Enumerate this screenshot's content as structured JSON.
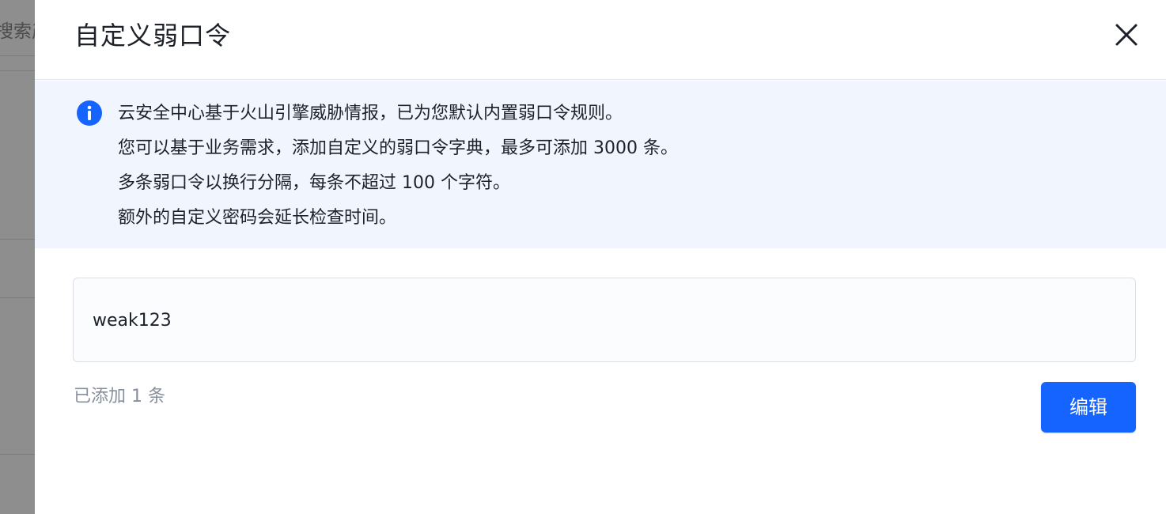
{
  "background": {
    "search_fragment": "搜索产"
  },
  "drawer": {
    "title": "自定义弱口令",
    "notice": {
      "lines": [
        "云安全中心基于火山引擎威胁情报，已为您默认内置弱口令规则。",
        "您可以基于业务需求，添加自定义的弱口令字典，最多可添加 3000 条。",
        "多条弱口令以换行分隔，每条不超过 100 个字符。",
        "额外的自定义密码会延长检查时间。"
      ]
    },
    "textarea_value": "weak123",
    "added_count_text": "已添加 1 条",
    "edit_button_label": "编辑"
  },
  "icons": {
    "close": "close-icon",
    "info": "info-icon"
  },
  "colors": {
    "primary": "#1664ff",
    "notice_bg": "#f1f5fe",
    "muted_text": "#86909c"
  }
}
